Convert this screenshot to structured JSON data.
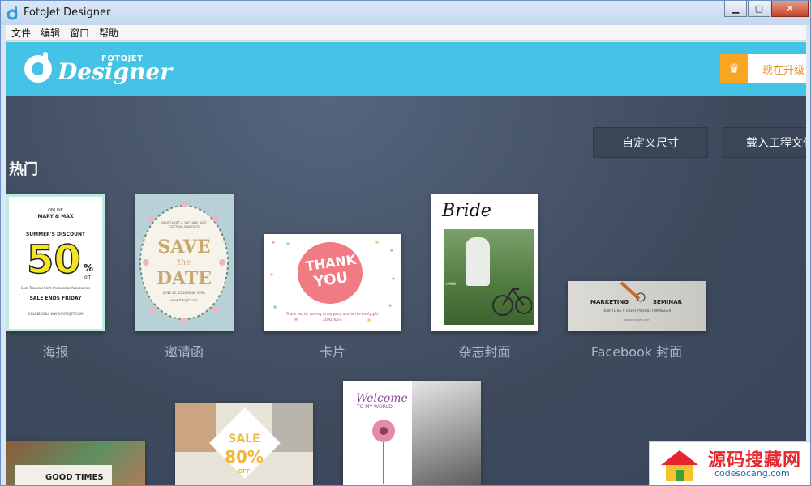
{
  "window": {
    "title": "FotoJet Designer"
  },
  "menu": [
    {
      "label": "文件"
    },
    {
      "label": "编辑"
    },
    {
      "label": "窗口"
    },
    {
      "label": "帮助"
    }
  ],
  "header": {
    "logo_small": "FOTOJET",
    "logo_main": "Designer",
    "upgrade_label": "现在升级",
    "accent": "#45c3e6",
    "upgrade_color": "#f6a623"
  },
  "actions": {
    "custom_size": "自定义尺寸",
    "load_project": "载入工程文件"
  },
  "section": {
    "title": "热门"
  },
  "templates": [
    {
      "label": "海报"
    },
    {
      "label": "邀请函"
    },
    {
      "label": "卡片"
    },
    {
      "label": "杂志封面"
    },
    {
      "label": "Facebook 封面"
    }
  ],
  "poster": {
    "l1": "ONLINE",
    "l2": "MARY & MAX",
    "l3": "SUMMER'S DISCOUNT",
    "big": "50",
    "pct": "%",
    "off": "off",
    "cats": "Coat  Trousers  Skirt  Underwear  Accessories",
    "ends": "SALE ENDS FRIDAY",
    "site": "ONLINE ONLY WWW.FOTOJET.COM"
  },
  "invite": {
    "top": "MARGARET & MICHAEL ARE GETTING MARRIED",
    "save": "SAVE",
    "the": "the",
    "date": "DATE",
    "when": "JUNE 25, 2016 NEW YORK",
    "site": "www.fotojet.com"
  },
  "card": {
    "t1": "THANK",
    "t2": "YOU",
    "msg": "Thank you for coming to my party and for the lovely gift!",
    "sign": "XOXO, KATE"
  },
  "magazine": {
    "title": "Bride",
    "sub": "LAWN"
  },
  "facebook": {
    "w1": "MARKETING",
    "w2": "SEMINAR",
    "sub": "HOW TO BE A GREAT PRODUCT MANAGER",
    "site": "WWW.FOTOJET.COM"
  },
  "row2": {
    "good": "GOOD TIMES",
    "sale": "SALE",
    "pct": "80%",
    "off": "OFF",
    "welcome": "Welcome",
    "tomy": "TO MY WORLD"
  },
  "watermark": {
    "main": "源码搜藏网",
    "sub": "codesocang.com"
  }
}
